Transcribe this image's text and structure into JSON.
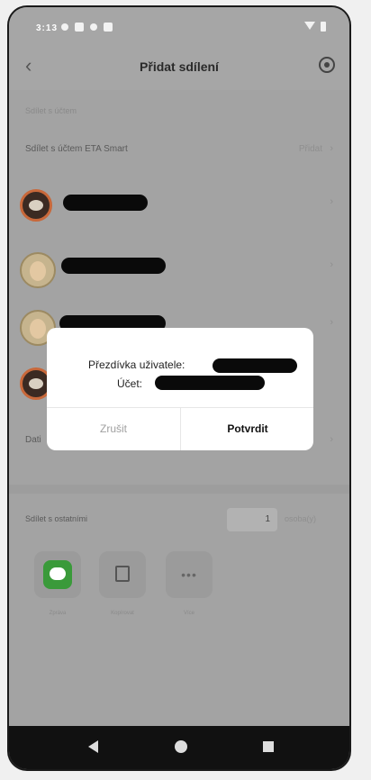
{
  "status_bar": {
    "time": "3:13"
  },
  "header": {
    "title": "Přidat sdílení"
  },
  "section_label": "Sdílet s účtem",
  "eta_row": {
    "label": "Sdílet s účtem ETA Smart",
    "action": "Přidat"
  },
  "users": [
    {
      "avatar": "eye"
    },
    {
      "avatar": "girl"
    },
    {
      "avatar": "girl"
    },
    {
      "avatar": "eye"
    }
  ],
  "partial_row_label": "Dati",
  "others": {
    "label": "Sdílet s ostatními",
    "count": "1",
    "unit": "osoba(y)"
  },
  "share_options": [
    {
      "label": "Zpráva",
      "icon": "message-icon"
    },
    {
      "label": "Kopírovat",
      "icon": "copy-icon"
    },
    {
      "label": "Více",
      "icon": "more-icon"
    }
  ],
  "dialog": {
    "nickname_label": "Přezdívka uživatele:",
    "account_label": "Účet:",
    "cancel": "Zrušit",
    "confirm": "Potvrdit"
  }
}
